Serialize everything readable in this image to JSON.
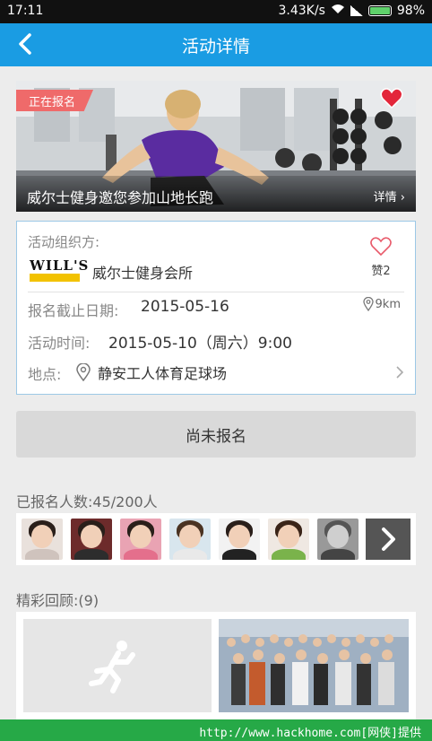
{
  "status_bar": {
    "time": "17:11",
    "speed": "3.43K/s",
    "battery": "98%"
  },
  "header": {
    "title": "活动详情",
    "back_icon": "chevron-left-icon"
  },
  "hero": {
    "tag": "正在报名",
    "title": "威尔士健身邀您参加山地长跑",
    "more_label": "详情 ›",
    "fav_icon": "heart-icon"
  },
  "info": {
    "organizer_label": "活动组织方:",
    "organizer_logo_text": "WILL'S",
    "organizer_name": "威尔士健身会所",
    "like_label": "赞2",
    "deadline_label": "报名截止日期:",
    "deadline_value": "2015-05-16",
    "distance": "9km",
    "time_label": "活动时间:",
    "time_value": "2015-05-10（周六）9:00",
    "location_label": "地点:",
    "location_value": "静安工人体育足球场"
  },
  "signup_button": "尚未报名",
  "participants": {
    "label": "已报名人数:45/200人",
    "avatar_count": 7
  },
  "review": {
    "label": "精彩回顾:(9)"
  },
  "watermark": "http://www.hackhome.com[网侠]提供",
  "colors": {
    "header_bg": "#1a9ce3",
    "tag_bg": "#ef6a6a",
    "card_border": "#9cc8e6",
    "watermark_bg": "#26a947"
  }
}
